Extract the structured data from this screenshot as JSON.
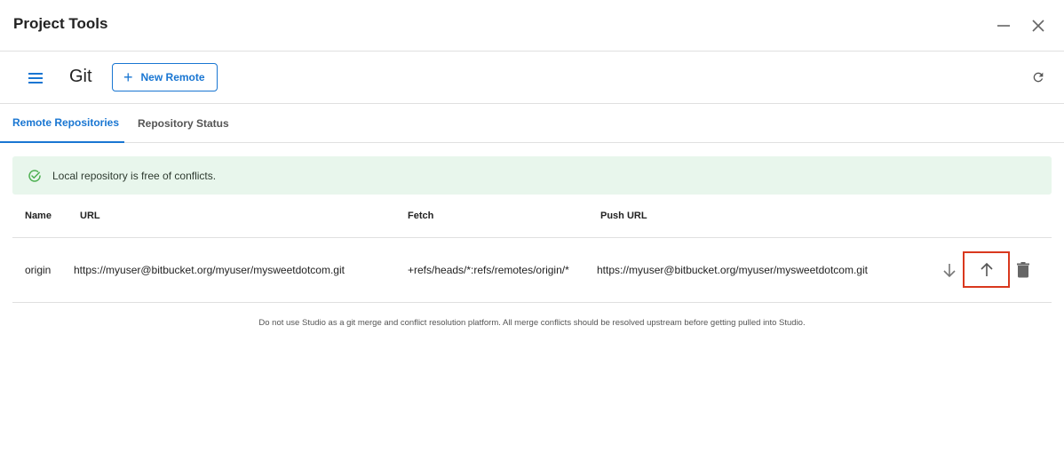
{
  "window": {
    "title": "Project Tools",
    "minimize_icon": "minimize-icon",
    "close_icon": "close-icon"
  },
  "toolbar": {
    "menu_icon": "hamburger-menu-icon",
    "section_title": "Git",
    "new_remote_icon": "plus-icon",
    "new_remote_label": "New Remote",
    "refresh_icon": "refresh-icon"
  },
  "tabs": [
    {
      "label": "Remote Repositories",
      "active": true
    },
    {
      "label": "Repository Status",
      "active": false
    }
  ],
  "alert": {
    "icon": "check-circle-icon",
    "text": "Local repository is free of conflicts.",
    "color": "#4caf50",
    "background": "#e8f6ec"
  },
  "table": {
    "columns": [
      "Name",
      "URL",
      "Fetch",
      "Push URL"
    ],
    "rows": [
      {
        "name": "origin",
        "url": "https://myuser@bitbucket.org/myuser/mysweetdotcom.git",
        "fetch": "+refs/heads/*:refs/remotes/origin/*",
        "push_url": "https://myuser@bitbucket.org/myuser/mysweetdotcom.git",
        "actions": [
          "arrow-down-icon",
          "arrow-up-icon",
          "trash-icon"
        ]
      }
    ]
  },
  "footer_note": "Do not use Studio as a git merge and conflict resolution platform. All merge conflicts should be resolved upstream before getting pulled into Studio.",
  "colors": {
    "accent": "#1976d2",
    "highlight_border": "#d9381e"
  }
}
